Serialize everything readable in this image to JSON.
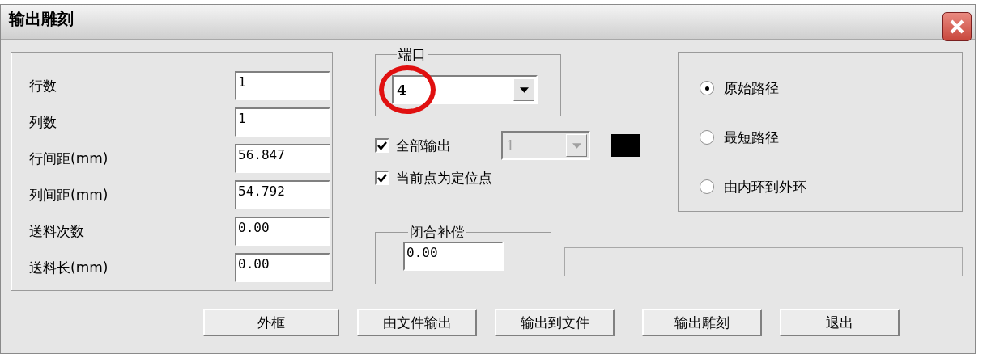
{
  "window": {
    "title": "输出雕刻"
  },
  "params": [
    {
      "label": "行数",
      "value": "1"
    },
    {
      "label": "列数",
      "value": "1"
    },
    {
      "label": "行间距(mm)",
      "value": "56.847"
    },
    {
      "label": "列间距(mm)",
      "value": "54.792"
    },
    {
      "label": "送料次数",
      "value": "0.00"
    },
    {
      "label": "送料长(mm)",
      "value": "0.00"
    }
  ],
  "port": {
    "label": "端口",
    "value": "4",
    "highlighted": true
  },
  "checks": [
    {
      "label": "全部输出",
      "checked": true
    },
    {
      "label": "当前点为定位点",
      "checked": true
    }
  ],
  "layer_select": {
    "value": "1",
    "disabled": true
  },
  "closure": {
    "label": "闭合补偿",
    "value": "0.00"
  },
  "paths": [
    {
      "label": "原始路径",
      "selected": true
    },
    {
      "label": "最短路径",
      "selected": false
    },
    {
      "label": "由内环到外环",
      "selected": false
    }
  ],
  "buttons": [
    "外框",
    "由文件输出",
    "输出到文件",
    "输出雕刻",
    "退出"
  ]
}
